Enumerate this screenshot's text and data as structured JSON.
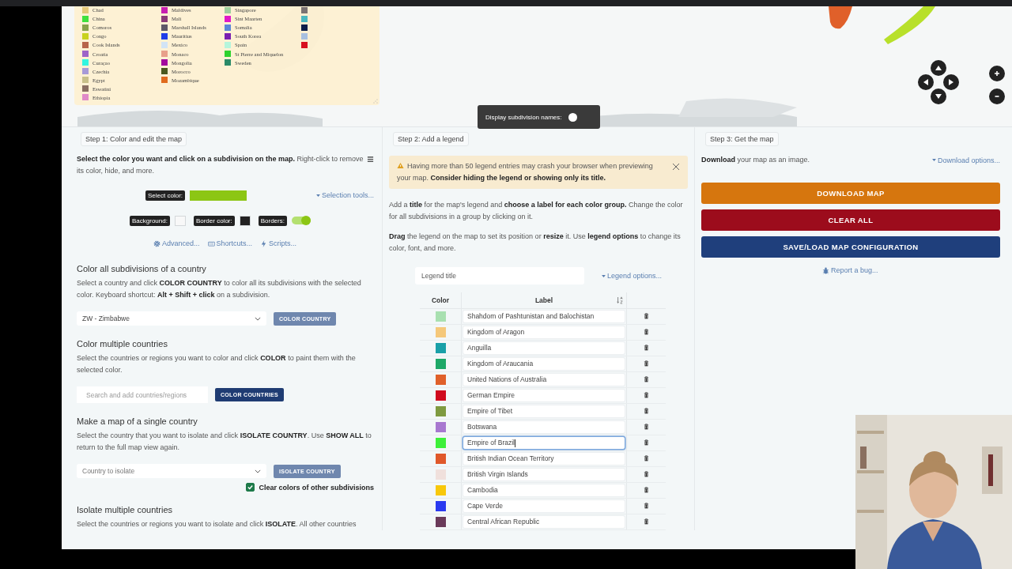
{
  "map": {
    "legend_columns": [
      [
        {
          "name": "Chad",
          "color": "#e3c87a"
        },
        {
          "name": "China",
          "color": "#3ee03e"
        },
        {
          "name": "Comoros",
          "color": "#86a24c"
        },
        {
          "name": "Congo",
          "color": "#c8d21e"
        },
        {
          "name": "Cook Islands",
          "color": "#b8654a"
        },
        {
          "name": "Croatia",
          "color": "#9d63c8"
        },
        {
          "name": "Curaçao",
          "color": "#33f5e0"
        },
        {
          "name": "Czechia",
          "color": "#a79ad8"
        },
        {
          "name": "Egypt",
          "color": "#c8c08a"
        },
        {
          "name": "Eswatini",
          "color": "#8a6f63"
        },
        {
          "name": "Ethiopia",
          "color": "#e08ac8"
        }
      ],
      [
        {
          "name": "Maldives",
          "color": "#c71fb0"
        },
        {
          "name": "Mali",
          "color": "#8a3a78"
        },
        {
          "name": "Marshall Islands",
          "color": "#5d5868"
        },
        {
          "name": "Mauritius",
          "color": "#1f3de8"
        },
        {
          "name": "Mexico",
          "color": "#d2e4f5"
        },
        {
          "name": "Monaco",
          "color": "#e8a08a"
        },
        {
          "name": "Mongolia",
          "color": "#a30a9d"
        },
        {
          "name": "Morocco",
          "color": "#4a5a1e"
        },
        {
          "name": "Mozambique",
          "color": "#e06b1e"
        }
      ],
      [
        {
          "name": "Singapore",
          "color": "#9dcf9d"
        },
        {
          "name": "Sint Maarten",
          "color": "#e018c8"
        },
        {
          "name": "Somalia",
          "color": "#5a86d8"
        },
        {
          "name": "South Korea",
          "color": "#7a1eb0"
        },
        {
          "name": "Spain",
          "color": "#b5f5dc"
        },
        {
          "name": "St Pierre and Miquelon",
          "color": "#2ed22e"
        },
        {
          "name": "Sweden",
          "color": "#2a8a68"
        }
      ],
      [
        {
          "color": "#7a7272"
        },
        {
          "color": "#4ab8c0"
        },
        {
          "color": "#0c1e4a"
        },
        {
          "color": "#a8c0e0"
        },
        {
          "color": "#d8101e"
        }
      ]
    ],
    "subdivision_names": {
      "label": "Display subdivision names:",
      "on": false
    }
  },
  "step1": {
    "tab": "Step 1: Color and edit the map",
    "intro": "**Select the color you want and click on a subdivision on the map.** Right-click to remove its color, hide, and more.",
    "select_color": {
      "label": "Select color:",
      "color": "#8cc614"
    },
    "selection_tools": "Selection tools...",
    "background": {
      "label": "Background:",
      "color": "#f8f8f8"
    },
    "border_color": {
      "label": "Border color:",
      "color": "#222222"
    },
    "borders": {
      "label": "Borders:",
      "on": true
    },
    "links": [
      {
        "kind": "gear",
        "label": "Advanced..."
      },
      {
        "kind": "keyboard",
        "label": "Shortcuts..."
      },
      {
        "kind": "bolt",
        "label": "Scripts..."
      }
    ],
    "sections": [
      {
        "title": "Color all subdivisions of a country",
        "text": "Select a country and click **COLOR COUNTRY** to color all its subdivisions with the selected color. Keyboard shortcut: **Alt + Shift + click** on a subdivision.",
        "control": {
          "kind": "select",
          "value": "ZW - Zimbabwe"
        },
        "button": {
          "label": "COLOR COUNTRY",
          "disabled": true
        }
      },
      {
        "title": "Color multiple countries",
        "text": "Select the countries or regions you want to color and click **COLOR** to paint them with the selected color.",
        "control": {
          "kind": "search",
          "placeholder": "Search and add countries/regions"
        },
        "button": {
          "label": "COLOR COUNTRIES",
          "disabled": false
        }
      },
      {
        "title": "Make a map of a single country",
        "text": "Select the country that you want to isolate and click **ISOLATE COUNTRY**. Use **SHOW ALL** to return to the full map view again.",
        "control": {
          "kind": "select",
          "placeholder": "Country to isolate"
        },
        "button": {
          "label": "ISOLATE COUNTRY",
          "disabled": true
        },
        "checkbox": {
          "label": "Clear colors of other subdivisions",
          "checked": true
        }
      },
      {
        "title": "Isolate multiple countries",
        "text": "Select the countries or regions you want to isolate and click **ISOLATE**. All other countries"
      }
    ]
  },
  "step2": {
    "tab": "Step 2: Add a legend",
    "alert": "Having more than 50 legend entries may crash your browser when previewing your map. **Consider hiding the legend or showing only its title.**",
    "paragraphs": [
      "Add a **title** for the map's legend and **choose a label for each color group.** Change the color for all subdivisions in a group by clicking on it.",
      "**Drag** the legend on the map to set its position or **resize** it. Use **legend options** to change its color, font, and more."
    ],
    "legend_title": {
      "placeholder": "Legend title"
    },
    "legend_options": "Legend options...",
    "table": {
      "columns": [
        "Color",
        "Label"
      ],
      "rows": [
        {
          "color": "#a8e0b0",
          "label": "Shahdom of Pashtunistan and Balochistan",
          "focused": false
        },
        {
          "color": "#f5c87a",
          "label": "Kingdom of Aragon",
          "focused": false
        },
        {
          "color": "#1aa0a8",
          "label": "Anguilla",
          "focused": false
        },
        {
          "color": "#1ea868",
          "label": "Kingdom of Araucania",
          "focused": false
        },
        {
          "color": "#e0602a",
          "label": "United Nations of Australia",
          "focused": false
        },
        {
          "color": "#d00a1e",
          "label": "German Empire",
          "focused": false
        },
        {
          "color": "#7f9a40",
          "label": "Empire of Tibet",
          "focused": false
        },
        {
          "color": "#a878d0",
          "label": "Botswana",
          "focused": false
        },
        {
          "color": "#3ef03a",
          "label": "Empire of Brazil",
          "focused": true
        },
        {
          "color": "#e0582a",
          "label": "British Indian Ocean Territory",
          "focused": false
        },
        {
          "color": "#f0e0dc",
          "label": "British Virgin Islands",
          "focused": false
        },
        {
          "color": "#f8c80a",
          "label": "Cambodia",
          "focused": false
        },
        {
          "color": "#2a3af0",
          "label": "Cape Verde",
          "focused": false
        },
        {
          "color": "#6a3a5a",
          "label": "Central African Republic",
          "focused": false
        }
      ]
    }
  },
  "step3": {
    "tab": "Step 3: Get the map",
    "text": "**Download** your map as an image.",
    "download_options": "Download options...",
    "buttons": [
      {
        "label": "DOWNLOAD MAP",
        "color": "#d6760e"
      },
      {
        "label": "CLEAR ALL",
        "color": "#9c0c1c"
      },
      {
        "label": "SAVE/LOAD MAP CONFIGURATION",
        "color": "#1f3f7c"
      }
    ],
    "report": "Report a bug..."
  }
}
